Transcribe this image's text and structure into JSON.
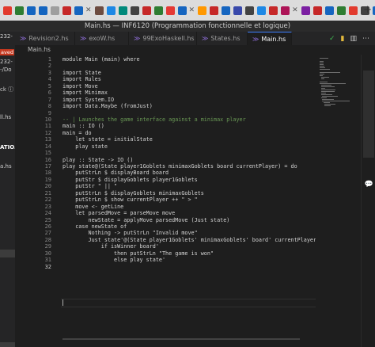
{
  "window": {
    "title": "Main.hs — INF6120 (Programmation fonctionnelle et logique)"
  },
  "browser": {
    "colors": [
      "#e23b2e",
      "#2e7d32",
      "#1565c0",
      "#1565c0",
      "#9e9e9e",
      "#c62828",
      "#1565c0",
      "#6d4c41",
      "#1e88e5",
      "#00897b",
      "#424242",
      "#c62828",
      "#2e7d32",
      "#e53935",
      "#1565c0",
      "#ff9800",
      "#c62828",
      "#1565c0",
      "#3949ab",
      "#424242",
      "#1e88e5",
      "#c62828",
      "#ad1457",
      "#7b1fa2",
      "#c62828",
      "#1565c0",
      "#2e7d32",
      "#e23b2e",
      "#424242",
      "#1565c0"
    ],
    "close_glyph": "✕",
    "new_tab_glyph": "+"
  },
  "left_panel": {
    "badge": "aved",
    "lines": [
      "232-",
      "-/Do",
      "ck ⓘ",
      "ll.hs",
      "ATIO..",
      "a.hs"
    ]
  },
  "tabs": [
    {
      "label": "Revision2.hs",
      "active": false
    },
    {
      "label": "exoW.hs",
      "active": false
    },
    {
      "label": "99ExoHaskell.hs",
      "active": false
    },
    {
      "label": "States.hs",
      "active": false
    },
    {
      "label": "Main.hs",
      "active": true
    }
  ],
  "tab_icon": "≫",
  "breadcrumb": "Main.hs",
  "editor": {
    "line_numbers": [
      "1",
      "2",
      "3",
      "4",
      "5",
      "6",
      "7",
      "8",
      "9",
      "10",
      "11",
      "12",
      "13",
      "14",
      "15",
      "16",
      "17",
      "18",
      "19",
      "20",
      "21",
      "22",
      "23",
      "24",
      "25",
      "26",
      "27",
      "28",
      "29",
      "30",
      "31",
      "32"
    ],
    "lines": [
      "module Main (main) where",
      "",
      "import State",
      "import Rules",
      "import Move",
      "import Minimax",
      "import System.IO",
      "import Data.Maybe (fromJust)",
      "",
      "-- | Launches the game interface against a minimax player",
      "main :: IO ()",
      "main = do",
      "    let state = initialState",
      "    play state",
      "",
      "play :: State -> IO ()",
      "play state@(State player1Goblets minimaxGoblets board currentPlayer) = do",
      "    putStrLn $ displayBoard board",
      "    putStr $ displayGoblets player1Goblets",
      "    putStr \" || \"",
      "    putStrLn $ displayGoblets minimaxGoblets",
      "    putStrLn $ show currentPlayer ++ \" > \"",
      "    move <- getLine",
      "    let parsedMove = parseMove move",
      "        newState = applyMove parsedMove (Just state)",
      "    case newState of",
      "        Nothing -> putStrLn \"Invalid move\"",
      "        Just state'@(State player1Goblets' minimaxGoblets' board' currentPlayer') -> d",
      "            if isWinner board'",
      "                then putStrLn \"The game is won\"",
      "                else play state'",
      ""
    ]
  },
  "toolbar": {
    "split_glyph": "≫",
    "check_glyph": "✓",
    "file_glyph": "▮",
    "layout_glyph": "▥",
    "more_glyph": "⋯"
  },
  "side_bubble": "💬"
}
